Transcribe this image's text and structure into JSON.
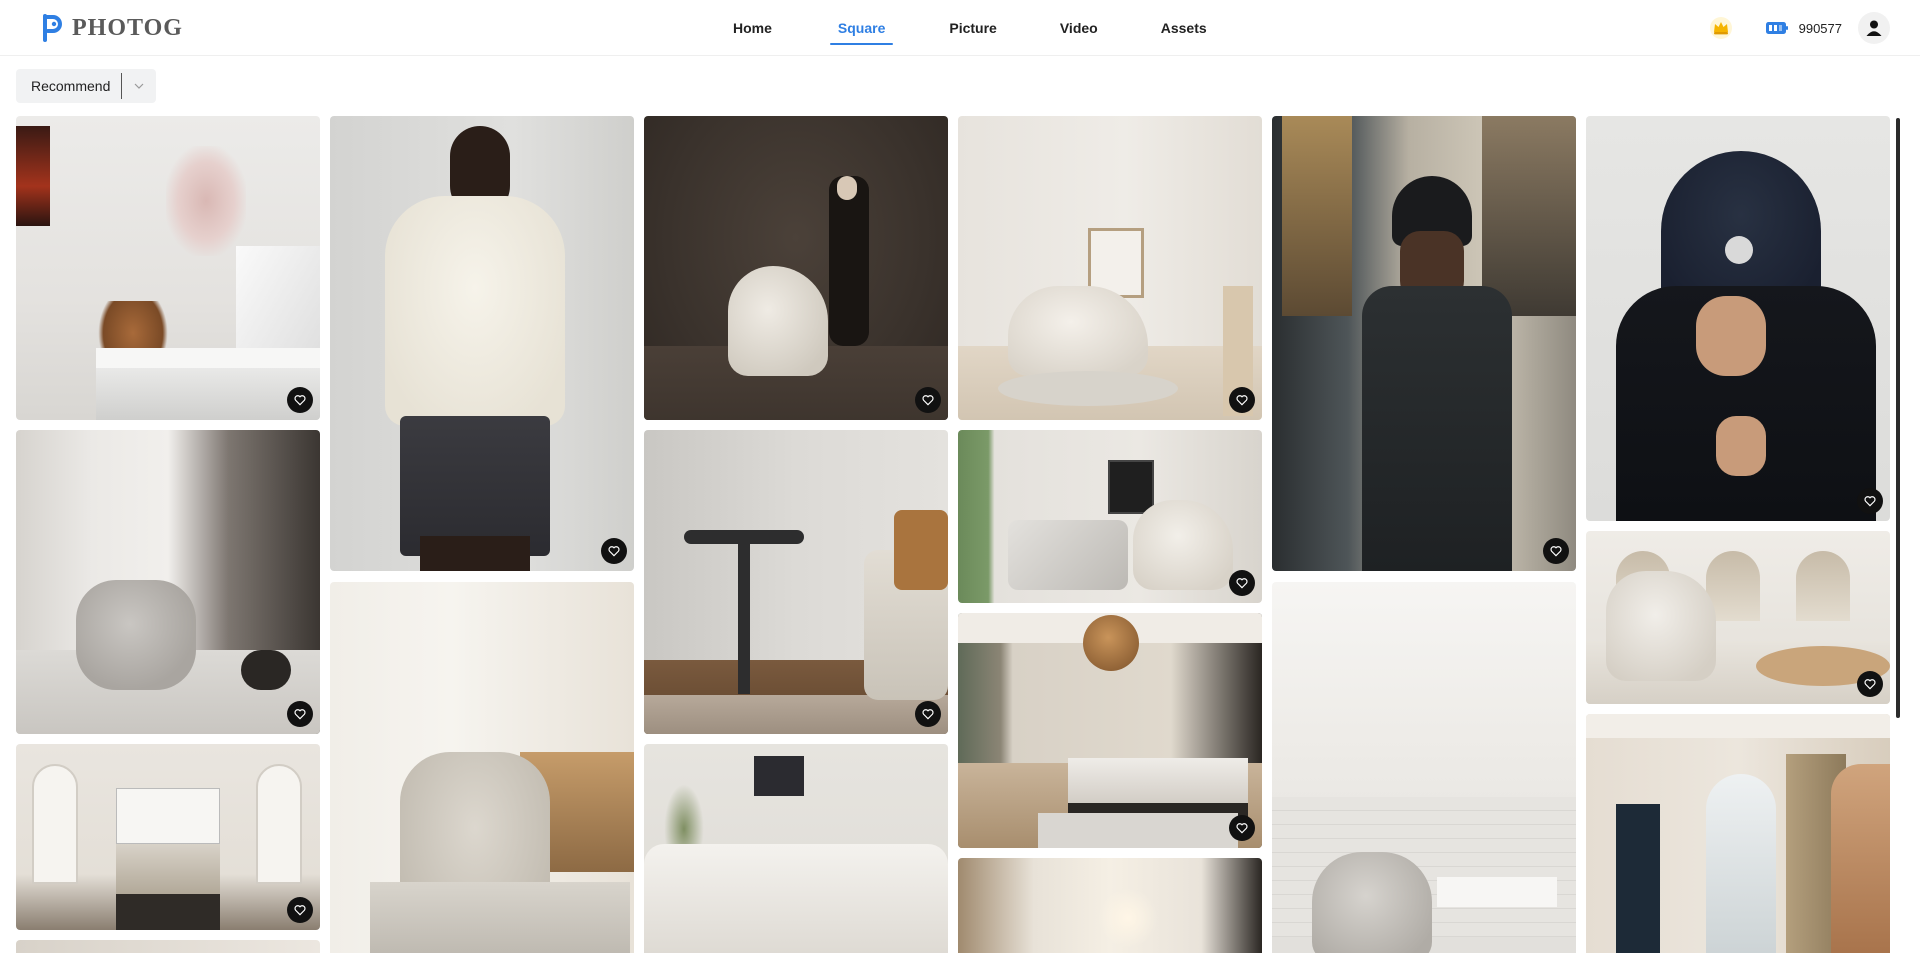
{
  "brand": {
    "name": "PHOTOG",
    "accent": "#2f7fe3"
  },
  "nav": {
    "items": [
      {
        "label": "Home",
        "active": false
      },
      {
        "label": "Square",
        "active": true
      },
      {
        "label": "Picture",
        "active": false
      },
      {
        "label": "Video",
        "active": false
      },
      {
        "label": "Assets",
        "active": false
      }
    ]
  },
  "account": {
    "credits": "990577",
    "icons": [
      "crown-icon",
      "token-icon",
      "user-icon"
    ]
  },
  "sort": {
    "selected": "Recommend"
  },
  "gallery": {
    "items": [
      {
        "subject": "teddy-bear-desk"
      },
      {
        "subject": "cream-hoodie-model"
      },
      {
        "subject": "man-walking-chair"
      },
      {
        "subject": "swivel-chair-room"
      },
      {
        "subject": "man-in-beanie-coat"
      },
      {
        "subject": "beanie-face-cover"
      },
      {
        "subject": "grey-armchair-interior"
      },
      {
        "subject": "side-table-sofa"
      },
      {
        "subject": "marble-table-chair"
      },
      {
        "subject": "arched-niches-chair"
      },
      {
        "subject": "bedroom-arched-doors"
      },
      {
        "subject": "lounge-chair-window"
      },
      {
        "subject": "bedroom-pendant-lamp"
      },
      {
        "subject": "armchair-tiled-wall"
      },
      {
        "subject": "white-sectional-sofa"
      },
      {
        "subject": "arched-window-room"
      },
      {
        "subject": "lamp-corner-room"
      }
    ]
  }
}
